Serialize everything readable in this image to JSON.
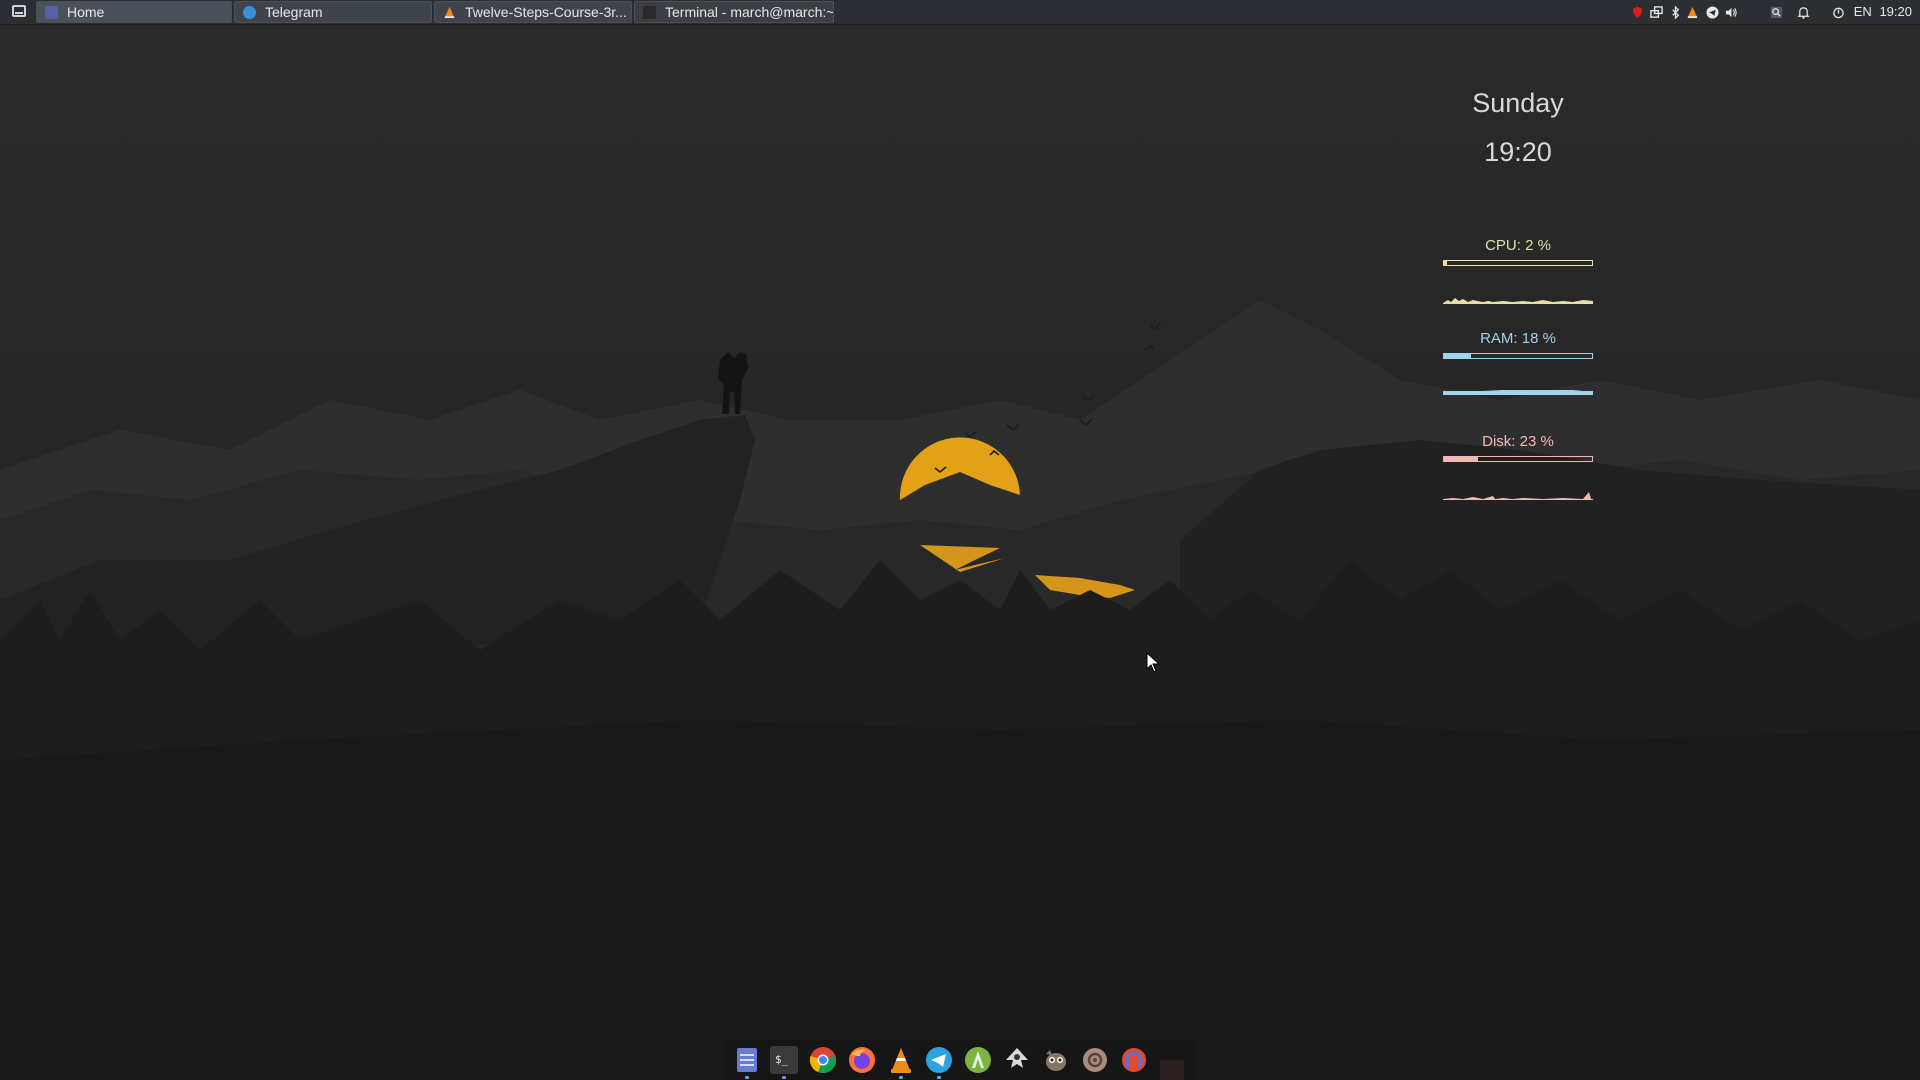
{
  "taskbar": {
    "tasks": [
      {
        "label": "Home"
      },
      {
        "label": "Telegram"
      },
      {
        "label": "Twelve-Steps-Course-3r..."
      },
      {
        "label": "Terminal - march@march:~"
      }
    ]
  },
  "system_tray": {
    "icons": [
      "shield-icon",
      "network-icon",
      "bluetooth-icon",
      "vlc-icon",
      "telegram-icon",
      "volume-icon",
      "search-icon",
      "bell-icon",
      "power-icon"
    ],
    "language": "EN",
    "time": "19:20"
  },
  "widget": {
    "day": "Sunday",
    "time": "19:20",
    "cpu": {
      "label": "CPU: 2 %",
      "percent": 2,
      "color": "#e8dfa8"
    },
    "ram": {
      "label": "RAM: 18 %",
      "percent": 18,
      "color": "#9fd4ea"
    },
    "disk": {
      "label": "Disk: 23 %",
      "percent": 23,
      "color": "#f1b9b3"
    }
  },
  "dock": {
    "apps": [
      "file-manager-icon",
      "terminal-icon",
      "chrome-icon",
      "firefox-icon",
      "vlc-icon",
      "telegram-icon",
      "android-studio-icon",
      "inkscape-icon",
      "gimp-icon",
      "settings-icon",
      "podcast-icon"
    ],
    "terminal_glyph": "$_"
  },
  "colors": {
    "sun": "#e2a117",
    "accent_indicator": "#5aa0ff",
    "panel": "#2b2e33"
  }
}
